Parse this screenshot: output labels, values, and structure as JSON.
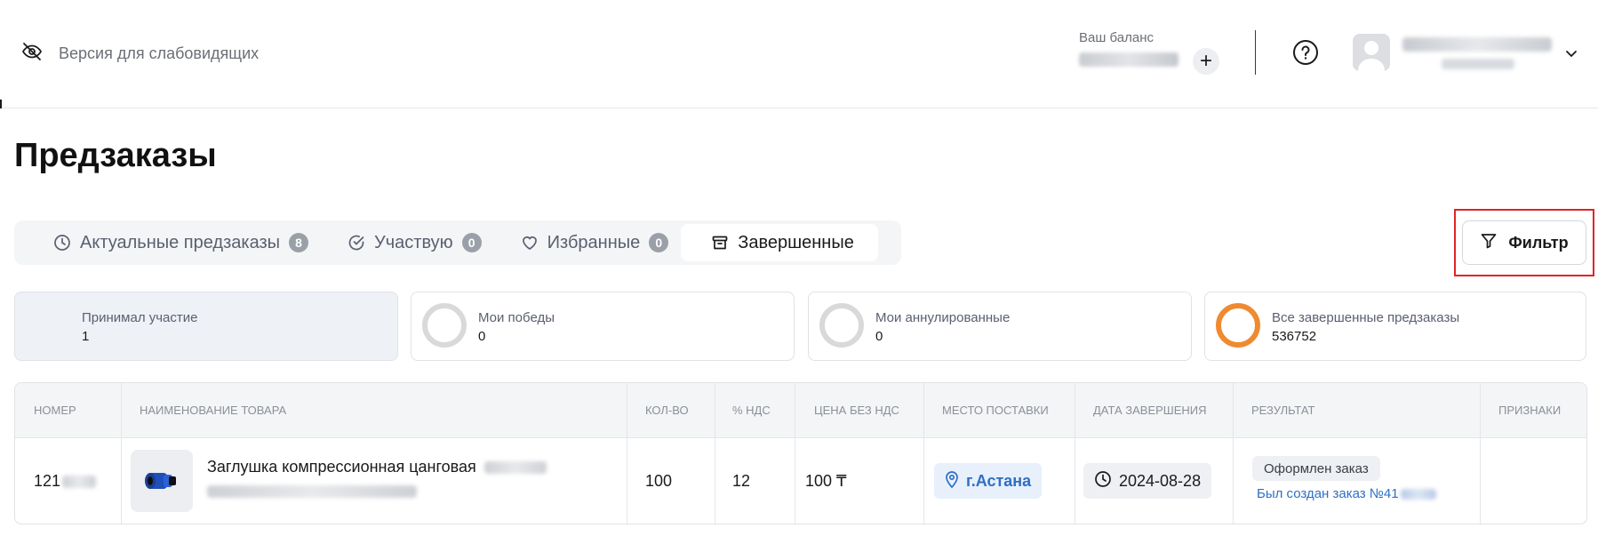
{
  "header": {
    "accessibility_label": "Версия для слабовидящих",
    "balance_caption": "Ваш баланс",
    "add_label": "+"
  },
  "page": {
    "title": "Предзаказы"
  },
  "tabs": [
    {
      "label": "Актуальные предзаказы",
      "count": "8",
      "icon": "clock-icon"
    },
    {
      "label": "Участвую",
      "count": "0",
      "icon": "check-circle-icon"
    },
    {
      "label": "Избранные",
      "count": "0",
      "icon": "heart-icon"
    },
    {
      "label": "Завершенные",
      "icon": "archive-icon",
      "active": true
    }
  ],
  "filter": {
    "label": "Фильтр",
    "icon": "filter-icon"
  },
  "stats": [
    {
      "label": "Принимал участие",
      "value": "1"
    },
    {
      "label": "Мои победы",
      "value": "0"
    },
    {
      "label": "Мои аннулированные",
      "value": "0"
    },
    {
      "label": "Все завершенные предзаказы",
      "value": "536752",
      "accent": "#ef8a31"
    }
  ],
  "table": {
    "columns": [
      "НОМЕР",
      "НАИМЕНОВАНИЕ ТОВАРА",
      "КОЛ-ВО",
      "% НДС",
      "ЦЕНА БЕЗ НДС",
      "МЕСТО ПОСТАВКИ",
      "ДАТА ЗАВЕРШЕНИЯ",
      "РЕЗУЛЬТАТ",
      "ПРИЗНАКИ"
    ],
    "rows": [
      {
        "number": "121",
        "product": "Заглушка компрессионная цанговая",
        "quantity": "100",
        "vat": "12",
        "price": "100 ₸",
        "location": "г.Астана",
        "date": "2024-08-28",
        "result_badge": "Оформлен заказ",
        "result_link": "Был создан заказ №41"
      }
    ]
  },
  "colors": {
    "accent": "#ef8a31",
    "link": "#2f6fc4",
    "highlight": "#e02424"
  }
}
